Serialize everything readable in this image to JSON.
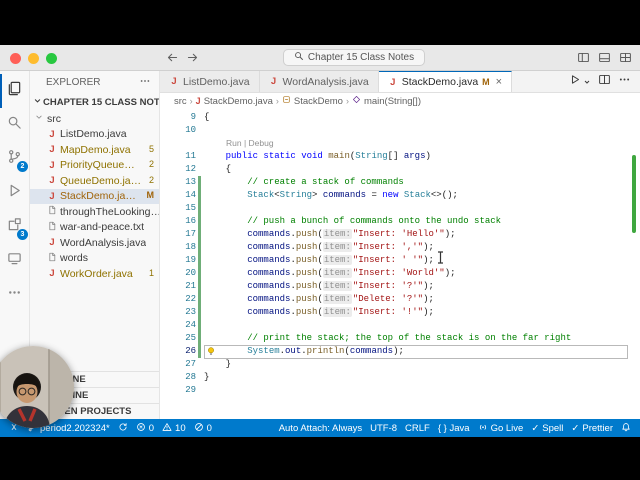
{
  "colors": {
    "accent": "#007acc",
    "status_bg": "#007acc",
    "java_icon": "#cc4b41",
    "warning_badge": "#8f7200",
    "git_modified": "#a0640a",
    "added_marker": "#3fa73f"
  },
  "title_bar": {
    "search_label": "Chapter 15 Class Notes"
  },
  "activity_bar": {
    "items": [
      {
        "id": "explorer",
        "active": true
      },
      {
        "id": "search"
      },
      {
        "id": "source-control",
        "badge": "2"
      },
      {
        "id": "run-debug"
      },
      {
        "id": "extensions",
        "badge": "3"
      },
      {
        "id": "remote-explorer"
      },
      {
        "id": "more"
      }
    ]
  },
  "sidebar": {
    "header": "EXPLORER",
    "section_title": "CHAPTER 15 CLASS NOT…",
    "tree": [
      {
        "label": "src",
        "kind": "folder",
        "expanded": true
      },
      {
        "label": "ListDemo.java",
        "kind": "java"
      },
      {
        "label": "MapDemo.java",
        "kind": "java",
        "badge": "5"
      },
      {
        "label": "PriorityQueue…",
        "kind": "java",
        "badge": "2"
      },
      {
        "label": "QueueDemo.ja…",
        "kind": "java",
        "badge": "2"
      },
      {
        "label": "StackDemo.ja…",
        "kind": "java",
        "badge": "M",
        "selected": true,
        "modified": true
      },
      {
        "label": "throughTheLooking…",
        "kind": "file"
      },
      {
        "label": "war-and-peace.txt",
        "kind": "file"
      },
      {
        "label": "WordAnalysis.java",
        "kind": "java"
      },
      {
        "label": "words",
        "kind": "file"
      },
      {
        "label": "WorkOrder.java",
        "kind": "java",
        "badge": "1"
      }
    ],
    "bottom_sections": [
      "OUTLINE",
      "TIMELINE",
      "MAVEN PROJECTS"
    ]
  },
  "editor_tabs": [
    {
      "label": "ListDemo.java",
      "active": false
    },
    {
      "label": "WordAnalysis.java",
      "active": false
    },
    {
      "label": "StackDemo.java",
      "active": true,
      "git_badge": "M",
      "close": "×"
    }
  ],
  "breadcrumb_separator": "›",
  "breadcrumb": [
    {
      "label": "src"
    },
    {
      "label": "StackDemo.java",
      "icon": "java"
    },
    {
      "label": "StackDemo",
      "icon": "class"
    },
    {
      "label": "main(String[])",
      "icon": "method"
    }
  ],
  "editor": {
    "codelens": "Run | Debug",
    "lines": [
      {
        "n": 9,
        "tokens": [
          [
            "p",
            "{"
          ]
        ]
      },
      {
        "n": 10,
        "tokens": []
      },
      {
        "lens": true
      },
      {
        "n": 11,
        "tokens": [
          [
            "p",
            "    "
          ],
          [
            "k",
            "public"
          ],
          [
            "p",
            " "
          ],
          [
            "k",
            "static"
          ],
          [
            "p",
            " "
          ],
          [
            "k",
            "void"
          ],
          [
            "p",
            " "
          ],
          [
            "fn",
            "main"
          ],
          [
            "p",
            "("
          ],
          [
            "ty",
            "String"
          ],
          [
            "p",
            "[] "
          ],
          [
            "v",
            "args"
          ],
          [
            "p",
            ")"
          ]
        ]
      },
      {
        "n": 12,
        "tokens": [
          [
            "p",
            "    {"
          ]
        ]
      },
      {
        "n": 13,
        "git": true,
        "tokens": [
          [
            "c",
            "        // create a stack of commands"
          ]
        ]
      },
      {
        "n": 14,
        "git": true,
        "tokens": [
          [
            "p",
            "        "
          ],
          [
            "ty",
            "Stack"
          ],
          [
            "p",
            "<"
          ],
          [
            "ty",
            "String"
          ],
          [
            "p",
            "> "
          ],
          [
            "v",
            "commands"
          ],
          [
            "p",
            " = "
          ],
          [
            "k",
            "new"
          ],
          [
            "p",
            " "
          ],
          [
            "ty",
            "Stack"
          ],
          [
            "p",
            "<>();"
          ]
        ]
      },
      {
        "n": 15,
        "git": true,
        "tokens": []
      },
      {
        "n": 16,
        "git": true,
        "tokens": [
          [
            "c",
            "        // push a bunch of commands onto the undo stack"
          ]
        ]
      },
      {
        "n": 17,
        "git": true,
        "tokens": [
          [
            "p",
            "        "
          ],
          [
            "v",
            "commands"
          ],
          [
            "p",
            "."
          ],
          [
            "fn",
            "push"
          ],
          [
            "p",
            "("
          ],
          [
            "ih",
            "item:"
          ],
          [
            "s",
            "\"Insert: 'Hello'\""
          ],
          [
            "p",
            ");"
          ]
        ]
      },
      {
        "n": 18,
        "git": true,
        "tokens": [
          [
            "p",
            "        "
          ],
          [
            "v",
            "commands"
          ],
          [
            "p",
            "."
          ],
          [
            "fn",
            "push"
          ],
          [
            "p",
            "("
          ],
          [
            "ih",
            "item:"
          ],
          [
            "s",
            "\"Insert: ','\""
          ],
          [
            "p",
            ");"
          ]
        ]
      },
      {
        "n": 19,
        "git": true,
        "tokens": [
          [
            "p",
            "        "
          ],
          [
            "v",
            "commands"
          ],
          [
            "p",
            "."
          ],
          [
            "fn",
            "push"
          ],
          [
            "p",
            "("
          ],
          [
            "ih",
            "item:"
          ],
          [
            "s",
            "\"Insert: ' '\""
          ],
          [
            "p",
            ");"
          ]
        ]
      },
      {
        "n": 20,
        "git": true,
        "tokens": [
          [
            "p",
            "        "
          ],
          [
            "v",
            "commands"
          ],
          [
            "p",
            "."
          ],
          [
            "fn",
            "push"
          ],
          [
            "p",
            "("
          ],
          [
            "ih",
            "item:"
          ],
          [
            "s",
            "\"Insert: 'World'\""
          ],
          [
            "p",
            ");"
          ]
        ]
      },
      {
        "n": 21,
        "git": true,
        "tokens": [
          [
            "p",
            "        "
          ],
          [
            "v",
            "commands"
          ],
          [
            "p",
            "."
          ],
          [
            "fn",
            "push"
          ],
          [
            "p",
            "("
          ],
          [
            "ih",
            "item:"
          ],
          [
            "s",
            "\"Insert: '?'\""
          ],
          [
            "p",
            ");"
          ]
        ]
      },
      {
        "n": 22,
        "git": true,
        "tokens": [
          [
            "p",
            "        "
          ],
          [
            "v",
            "commands"
          ],
          [
            "p",
            "."
          ],
          [
            "fn",
            "push"
          ],
          [
            "p",
            "("
          ],
          [
            "ih",
            "item:"
          ],
          [
            "s",
            "\"Delete: '?'\""
          ],
          [
            "p",
            ");"
          ]
        ]
      },
      {
        "n": 23,
        "git": true,
        "tokens": [
          [
            "p",
            "        "
          ],
          [
            "v",
            "commands"
          ],
          [
            "p",
            "."
          ],
          [
            "fn",
            "push"
          ],
          [
            "p",
            "("
          ],
          [
            "ih",
            "item:"
          ],
          [
            "s",
            "\"Insert: '!'\""
          ],
          [
            "p",
            ");"
          ]
        ]
      },
      {
        "n": 24,
        "git": true,
        "tokens": []
      },
      {
        "n": 25,
        "git": true,
        "tokens": [
          [
            "c",
            "        // print the stack; the top of the stack is on the far right"
          ]
        ]
      },
      {
        "n": 26,
        "git": true,
        "current": true,
        "tokens": [
          [
            "p",
            "        "
          ],
          [
            "ty",
            "System"
          ],
          [
            "p",
            "."
          ],
          [
            "v",
            "out"
          ],
          [
            "p",
            "."
          ],
          [
            "fn",
            "println"
          ],
          [
            "p",
            "("
          ],
          [
            "v",
            "commands"
          ],
          [
            "p",
            ");"
          ]
        ]
      },
      {
        "n": 27,
        "tokens": [
          [
            "p",
            "    }"
          ]
        ]
      },
      {
        "n": 28,
        "tokens": [
          [
            "p",
            "}"
          ]
        ]
      },
      {
        "n": 29,
        "tokens": []
      }
    ]
  },
  "status_bar": {
    "left": [
      {
        "name": "remote",
        "icon": "remote"
      },
      {
        "name": "git-branch",
        "icon": "branch",
        "label": "period2.202324*"
      },
      {
        "name": "sync",
        "icon": "sync"
      },
      {
        "name": "problems-errors",
        "icon": "error",
        "label": "0"
      },
      {
        "name": "problems-warnings",
        "icon": "warning",
        "label": "10"
      },
      {
        "name": "ports",
        "icon": "blocked",
        "label": "0"
      }
    ],
    "right": [
      {
        "name": "auto-attach",
        "label": "Auto Attach: Always"
      },
      {
        "name": "encoding",
        "label": "UTF-8"
      },
      {
        "name": "eol",
        "label": "CRLF"
      },
      {
        "name": "language-mode",
        "label": "{ } Java"
      },
      {
        "name": "go-live",
        "icon": "broadcast",
        "label": "Go Live"
      },
      {
        "name": "spell",
        "icon": "check",
        "label": "Spell"
      },
      {
        "name": "prettier",
        "icon": "check",
        "label": "Prettier"
      },
      {
        "name": "notifications",
        "icon": "bell"
      }
    ]
  }
}
